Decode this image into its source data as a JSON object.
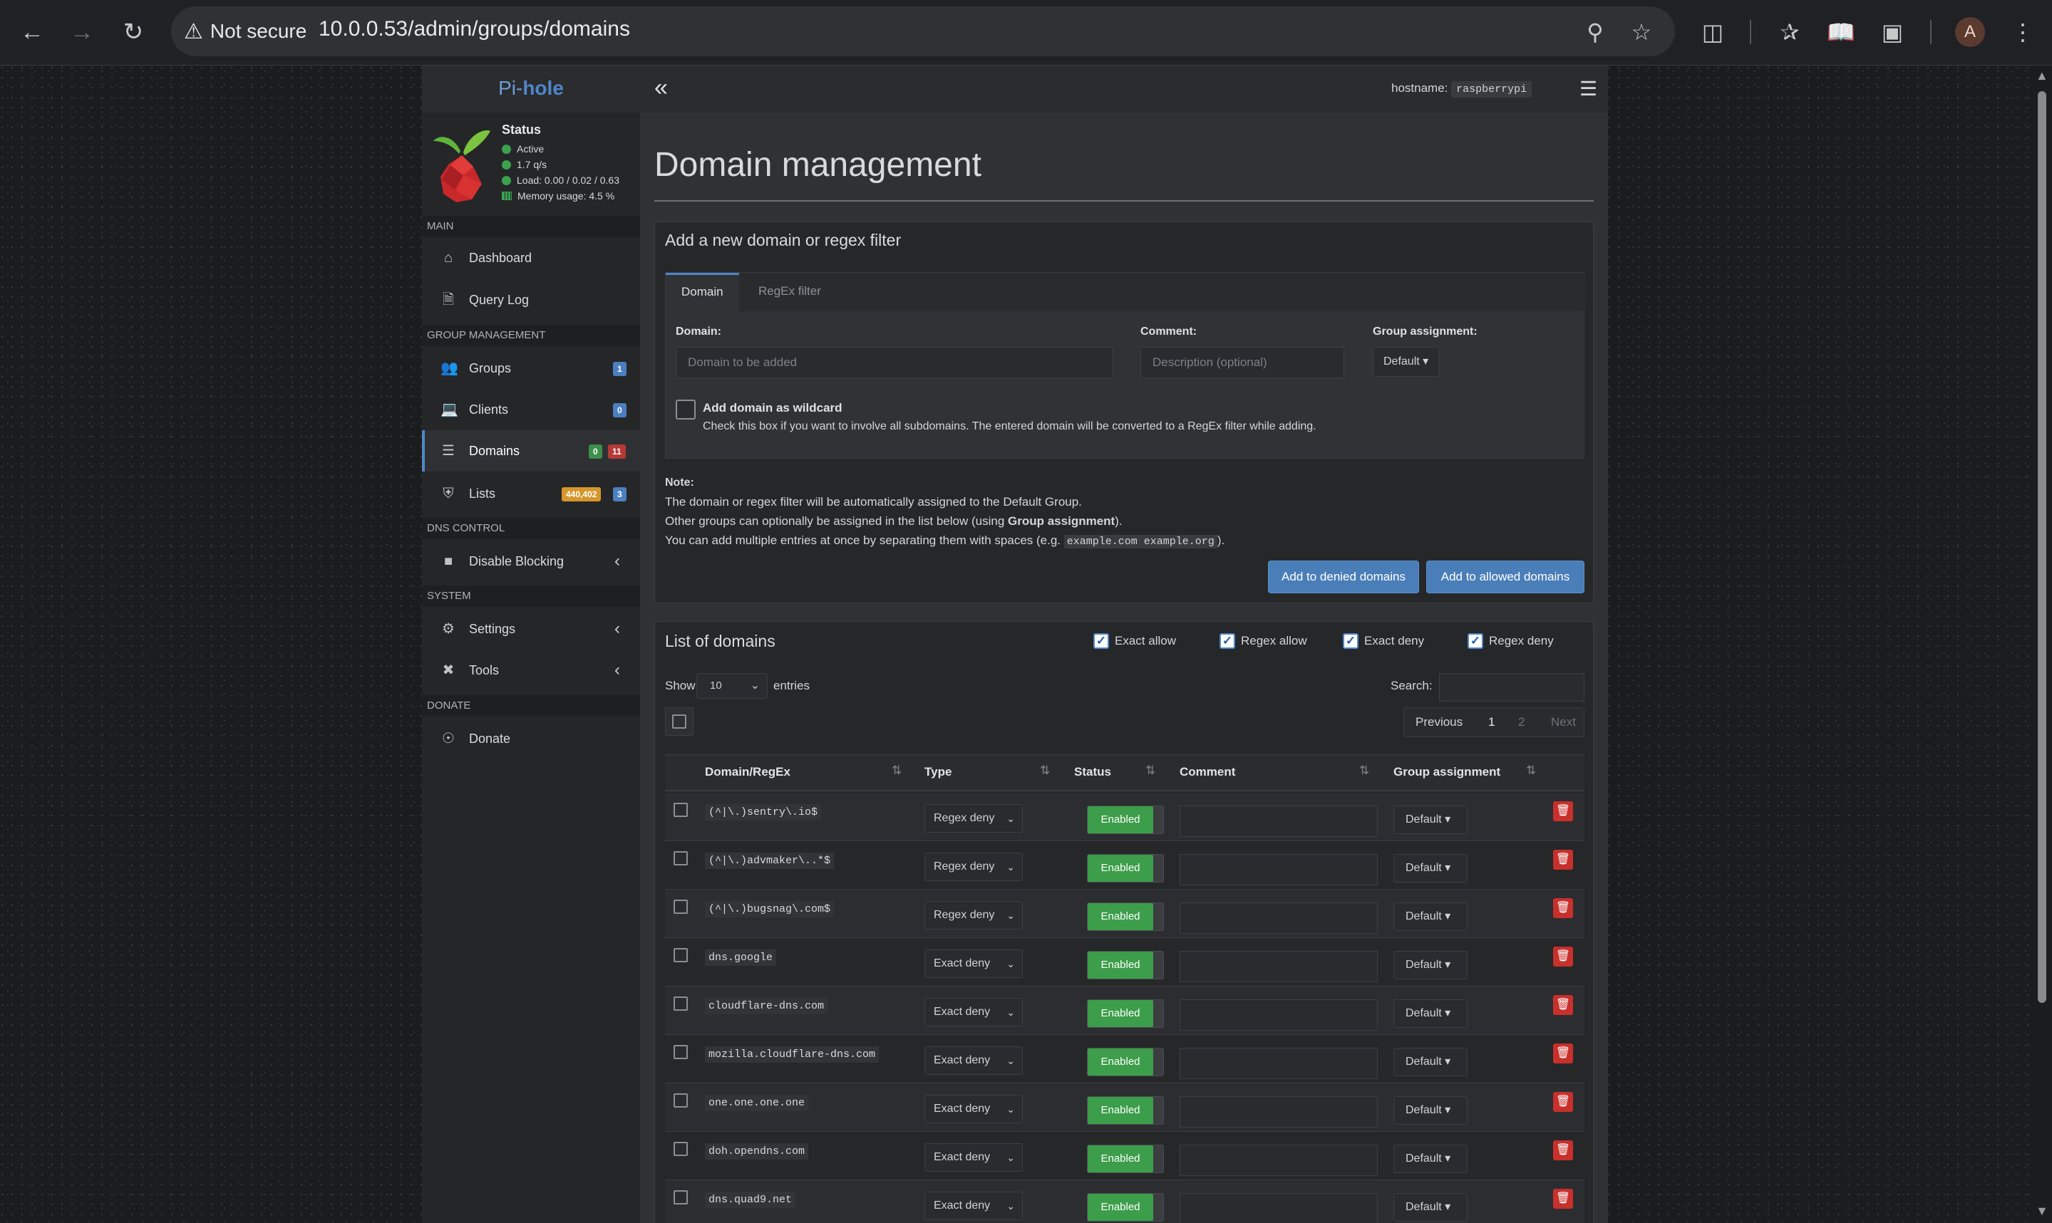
{
  "browser": {
    "security_label": "Not secure",
    "url": "10.0.0.53/admin/groups/domains",
    "avatar_letter": "A"
  },
  "sidebar": {
    "brand_prefix": "Pi-",
    "brand_suffix": "hole",
    "status": {
      "title": "Status",
      "active": "Active",
      "rate": "1.7 q/s",
      "load": "Load: 0.00 / 0.02 / 0.63",
      "memory": "Memory usage: 4.5 %"
    },
    "sections": {
      "main": "MAIN",
      "group_management": "GROUP MANAGEMENT",
      "dns_control": "DNS CONTROL",
      "system": "SYSTEM",
      "donate": "DONATE"
    },
    "items": {
      "dashboard": "Dashboard",
      "query_log": "Query Log",
      "groups": "Groups",
      "groups_badge": "1",
      "clients": "Clients",
      "clients_badge": "0",
      "domains": "Domains",
      "domains_badge_green": "0",
      "domains_badge_red": "11",
      "lists": "Lists",
      "lists_badge_yellow": "440,402",
      "lists_badge_blue": "3",
      "disable_blocking": "Disable Blocking",
      "settings": "Settings",
      "tools": "Tools",
      "donate": "Donate"
    }
  },
  "topbar": {
    "hostname_label": "hostname:",
    "hostname_value": "raspberrypi"
  },
  "page": {
    "title": "Domain management"
  },
  "add_box": {
    "title": "Add a new domain or regex filter",
    "tab_domain": "Domain",
    "tab_regex": "RegEx filter",
    "domain_label": "Domain:",
    "domain_placeholder": "Domain to be added",
    "comment_label": "Comment:",
    "comment_placeholder": "Description (optional)",
    "group_label": "Group assignment:",
    "group_value": "Default",
    "wildcard_label": "Add domain as wildcard",
    "wildcard_help": "Check this box if you want to involve all subdomains. The entered domain will be converted to a RegEx filter while adding.",
    "note_title": "Note:",
    "note_1": "The domain or regex filter will be automatically assigned to the Default Group.",
    "note_2_pre": "Other groups can optionally be assigned in the list below (using ",
    "note_2_bold": "Group assignment",
    "note_2_post": ").",
    "note_3_pre": "You can add multiple entries at once by separating them with spaces (e.g. ",
    "note_3_code": "example.com example.org",
    "note_3_post": ").",
    "btn_deny": "Add to denied domains",
    "btn_allow": "Add to allowed domains"
  },
  "list_box": {
    "title": "List of domains",
    "filters": [
      "Exact allow",
      "Regex allow",
      "Exact deny",
      "Regex deny"
    ],
    "show_label": "Show",
    "show_value": "10",
    "entries_label": "entries",
    "search_label": "Search:",
    "pager": {
      "previous": "Previous",
      "page1": "1",
      "page2": "2",
      "next": "Next"
    },
    "columns": [
      "Domain/RegEx",
      "Type",
      "Status",
      "Comment",
      "Group assignment"
    ],
    "rows": [
      {
        "domain": "(^|\\.)sentry\\.io$",
        "type": "Regex deny",
        "status": "Enabled",
        "group": "Default"
      },
      {
        "domain": "(^|\\.)advmaker\\..*$",
        "type": "Regex deny",
        "status": "Enabled",
        "group": "Default"
      },
      {
        "domain": "(^|\\.)bugsnag\\.com$",
        "type": "Regex deny",
        "status": "Enabled",
        "group": "Default"
      },
      {
        "domain": "dns.google",
        "type": "Exact deny",
        "status": "Enabled",
        "group": "Default"
      },
      {
        "domain": "cloudflare-dns.com",
        "type": "Exact deny",
        "status": "Enabled",
        "group": "Default"
      },
      {
        "domain": "mozilla.cloudflare-dns.com",
        "type": "Exact deny",
        "status": "Enabled",
        "group": "Default"
      },
      {
        "domain": "one.one.one.one",
        "type": "Exact deny",
        "status": "Enabled",
        "group": "Default"
      },
      {
        "domain": "doh.opendns.com",
        "type": "Exact deny",
        "status": "Enabled",
        "group": "Default"
      },
      {
        "domain": "dns.quad9.net",
        "type": "Exact deny",
        "status": "Enabled",
        "group": "Default"
      }
    ]
  }
}
